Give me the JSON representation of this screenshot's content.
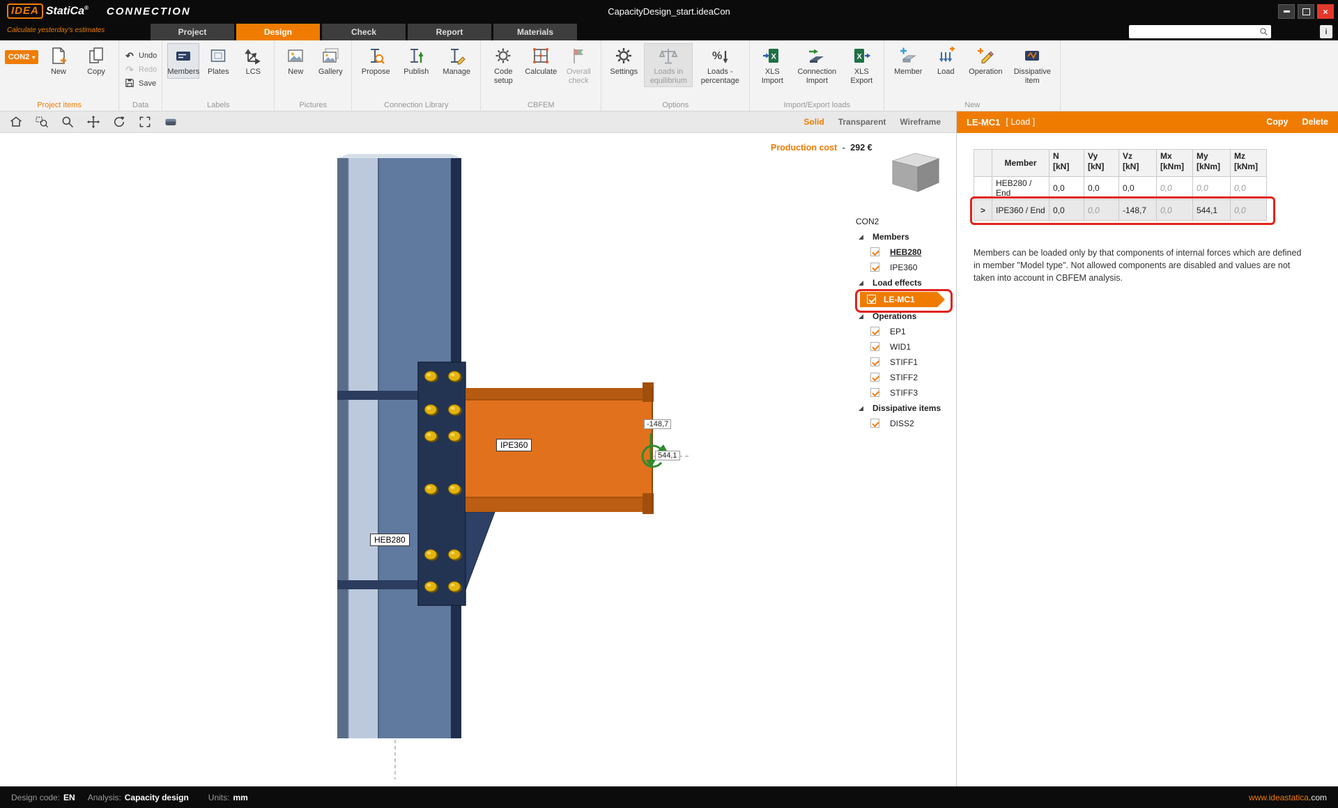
{
  "titlebar": {
    "logo_idea": "IDEA",
    "logo_statica": "StatiCa",
    "logo_reg": "®",
    "app_name": "CONNECTION",
    "tagline": "Calculate yesterday's estimates",
    "document_title": "CapacityDesign_start.ideaCon"
  },
  "search": {
    "value": ""
  },
  "tabs": [
    {
      "label": "Project"
    },
    {
      "label": "Design"
    },
    {
      "label": "Check"
    },
    {
      "label": "Report"
    },
    {
      "label": "Materials"
    }
  ],
  "ribbon": {
    "groups": {
      "project_items": {
        "label": "Project items",
        "con2": "CON2",
        "new": "New",
        "copy": "Copy"
      },
      "data": {
        "label": "Data",
        "undo": "Undo",
        "redo": "Redo",
        "save": "Save"
      },
      "labels": {
        "label": "Labels",
        "members": "Members",
        "plates": "Plates",
        "lcs": "LCS"
      },
      "pictures": {
        "label": "Pictures",
        "new": "New",
        "gallery": "Gallery"
      },
      "connection_library": {
        "label": "Connection Library",
        "propose": "Propose",
        "publish": "Publish",
        "manage": "Manage"
      },
      "cbfem": {
        "label": "CBFEM",
        "code_setup": "Code setup",
        "calculate": "Calculate",
        "overall_check": "Overall check"
      },
      "options": {
        "label": "Options",
        "settings": "Settings",
        "loads_in_equilibrium": "Loads in equilibrium",
        "loads_percentage": "Loads - percentage"
      },
      "import_export": {
        "label": "Import/Export loads",
        "xls_import": "XLS Import",
        "connection_import": "Connection Import",
        "xls_export": "XLS Export"
      },
      "new": {
        "label": "New",
        "member": "Member",
        "load": "Load",
        "operation": "Operation",
        "dissipative_item": "Dissipative item"
      }
    }
  },
  "viewport_toolbar": {
    "solid": "Solid",
    "transparent": "Transparent",
    "wireframe": "Wireframe"
  },
  "scene": {
    "production_cost_label": "Production cost",
    "production_cost_sep": "-",
    "production_cost_value": "292 €",
    "beam_label": "IPE360",
    "column_label": "HEB280",
    "shear_force": "-148,7",
    "bending_moment": "544,1"
  },
  "tree": {
    "root": "CON2",
    "groups": {
      "members": "Members",
      "load_effects": "Load effects",
      "operations": "Operations",
      "dissipative_items": "Dissipative items"
    },
    "members": [
      "HEB280",
      "IPE360"
    ],
    "load_effects": [
      "LE-MC1"
    ],
    "operations": [
      "EP1",
      "WID1",
      "STIFF1",
      "STIFF2",
      "STIFF3"
    ],
    "dissipative_items": [
      "DISS2"
    ]
  },
  "panel": {
    "title": "LE-MC1",
    "type": "[ Load ]",
    "copy": "Copy",
    "delete": "Delete",
    "table": {
      "col_member": "Member",
      "col_n": "N",
      "col_vy": "Vy",
      "col_vz": "Vz",
      "col_mx": "Mx",
      "col_my": "My",
      "col_mz": "Mz",
      "unit_kn": "[kN]",
      "unit_knm": "[kNm]",
      "expander": ">",
      "rows": [
        {
          "member": "HEB280 / End",
          "n": "0,0",
          "vy": "0,0",
          "vz": "0,0",
          "mx": "0,0",
          "my": "0,0",
          "mz": "0,0"
        },
        {
          "member": "IPE360 / End",
          "n": "0,0",
          "vy": "0,0",
          "vz": "-148,7",
          "mx": "0,0",
          "my": "544,1",
          "mz": "0,0"
        }
      ]
    },
    "note": "Members can be loaded only by that components of internal forces which are defined in member \"Model type\". Not allowed components are disabled and values are not taken into account in CBFEM analysis."
  },
  "statusbar": {
    "design_code_label": "Design code:",
    "design_code_value": "EN",
    "analysis_label": "Analysis:",
    "analysis_value": "Capacity design",
    "units_label": "Units:",
    "units_value": "mm",
    "website_name": "www.ideastatica",
    "website_tld": ".com"
  },
  "colors": {
    "accent_orange": "#ef7c00",
    "highlight_red": "#e0231c",
    "beam_orange": "#e2711e",
    "steel_blue": "#60799e",
    "navy": "#1f2e4d",
    "bolt_yellow": "#e3b30f",
    "arrow_green": "#2e8b2e",
    "excel_green": "#1e7145"
  }
}
